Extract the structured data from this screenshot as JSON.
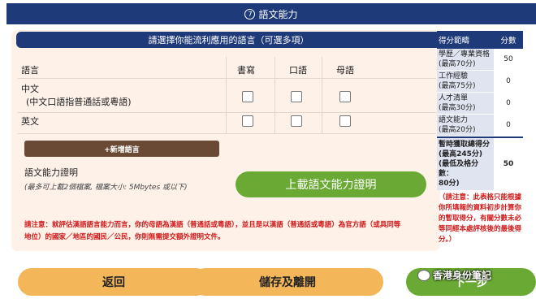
{
  "section": {
    "number": "7",
    "title": "語文能力"
  },
  "panel": {
    "header": "請選擇你能流利應用的語言（可選多項）"
  },
  "table": {
    "columns": {
      "language": "語言",
      "written": "書寫",
      "spoken": "口語",
      "native": "母語"
    },
    "rows": [
      {
        "name": "中文",
        "detail": "(中文口語指普通話或粵語)",
        "written": false,
        "spoken": false,
        "native": false
      },
      {
        "name": "英文",
        "detail": "",
        "written": false,
        "spoken": false,
        "native": false
      }
    ]
  },
  "add_language": "+新增語言",
  "proof": {
    "title": "語文能力證明",
    "hint": "(最多可上載2個檔案, 檔案大小: 5Mbytes 或以下)",
    "upload": "上載語文能力證明"
  },
  "notice": {
    "line1": "請注意：就評估漢語語言能力而言，你的母語為漢語（普通話或粵語），並且是以漢語（普通話或粵語）為官方語（或具同等",
    "line2": "地位）的國家／地區的國民／公民，你則無需提交額外證明文件。"
  },
  "scores": {
    "header": {
      "label": "得分範疇",
      "value": "分數"
    },
    "rows": [
      {
        "label": "學歷／專業資格",
        "max": "(最高70分)",
        "value": "50"
      },
      {
        "label": "工作經驗",
        "max": "(最高75分)",
        "value": "0"
      },
      {
        "label": "人才清單",
        "max": "(最高30分)",
        "value": "0"
      },
      {
        "label": "語文能力",
        "max": "(最高20分)",
        "value": "0"
      }
    ],
    "total": {
      "line1": "暫時獲取總得分",
      "line2": "(最高245分)",
      "line3": "(最低及格分數：",
      "line4": "80分)",
      "value": "50"
    },
    "note": "（請注意：此表格只能根據你所填報的資料初步計算你的暫取得分，有關分數未必等同經本處評核後的最後得分。）"
  },
  "buttons": {
    "back": "返回",
    "save_exit": "儲存及離開",
    "next": "下一步"
  },
  "watermark": "香港身份筆記",
  "colors": {
    "navy": "#1f3a78",
    "orange": "#f3b658",
    "green": "#6aaa34",
    "brown": "#6b4a35",
    "notice": "#d01a1a"
  }
}
